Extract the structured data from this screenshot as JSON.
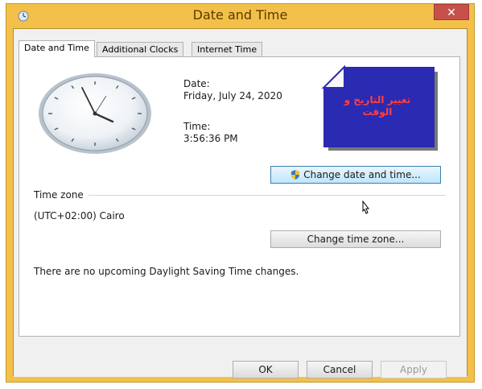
{
  "window": {
    "title": "Date and Time",
    "close_label": "✕"
  },
  "tabs": [
    {
      "label": "Date and Time",
      "active": true
    },
    {
      "label": "Additional Clocks",
      "active": false
    },
    {
      "label": "Internet Time",
      "active": false
    }
  ],
  "datetime": {
    "date_label": "Date:",
    "date_value": "Friday, July 24, 2020",
    "time_label": "Time:",
    "time_value": "3:56:36 PM",
    "change_datetime_button": "Change date and time..."
  },
  "note": {
    "text_line1": "تغيير التاريخ و",
    "text_line2": "الوقت"
  },
  "timezone": {
    "section_label": "Time zone",
    "value": "(UTC+02:00) Cairo",
    "change_button": "Change time zone..."
  },
  "dst_message": "There are no upcoming Daylight Saving Time changes.",
  "footer": {
    "ok": "OK",
    "cancel": "Cancel",
    "apply": "Apply"
  },
  "colors": {
    "title_bar": "#f3c04a",
    "close_button": "#c7504a",
    "note_border": "#2b2bd1",
    "note_text": "#ff4040"
  },
  "icons": {
    "app": "clock-icon",
    "close": "close-icon",
    "shield": "uac-shield-icon",
    "cursor": "mouse-pointer-icon"
  }
}
